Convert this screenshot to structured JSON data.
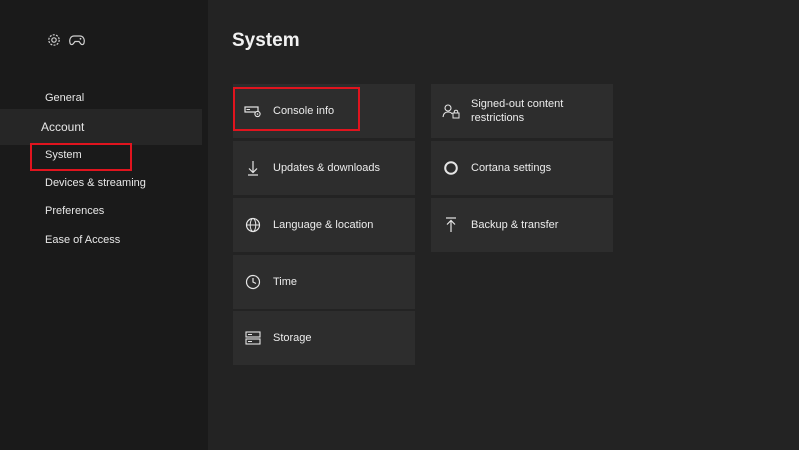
{
  "sidebar": {
    "items": [
      {
        "label": "General"
      },
      {
        "label": "Account"
      },
      {
        "label": "System"
      },
      {
        "label": "Devices & streaming"
      },
      {
        "label": "Preferences"
      },
      {
        "label": "Ease of Access"
      }
    ],
    "icons": [
      "gear-icon",
      "controller-icon"
    ]
  },
  "header": {
    "title": "System"
  },
  "tiles": [
    {
      "label": "Console info",
      "icon": "console-icon"
    },
    {
      "label": "Updates & downloads",
      "icon": "download-arrow-icon"
    },
    {
      "label": "Language & location",
      "icon": "globe-icon"
    },
    {
      "label": "Time",
      "icon": "clock-icon"
    },
    {
      "label": "Storage",
      "icon": "storage-icon"
    },
    {
      "label": "Signed-out content restrictions",
      "icon": "user-lock-icon"
    },
    {
      "label": "Cortana settings",
      "icon": "cortana-ring-icon"
    },
    {
      "label": "Backup & transfer",
      "icon": "upload-arrow-icon"
    }
  ],
  "colors": {
    "highlight": "#e0141e",
    "background": "#232323",
    "tile": "#2d2d2d"
  }
}
